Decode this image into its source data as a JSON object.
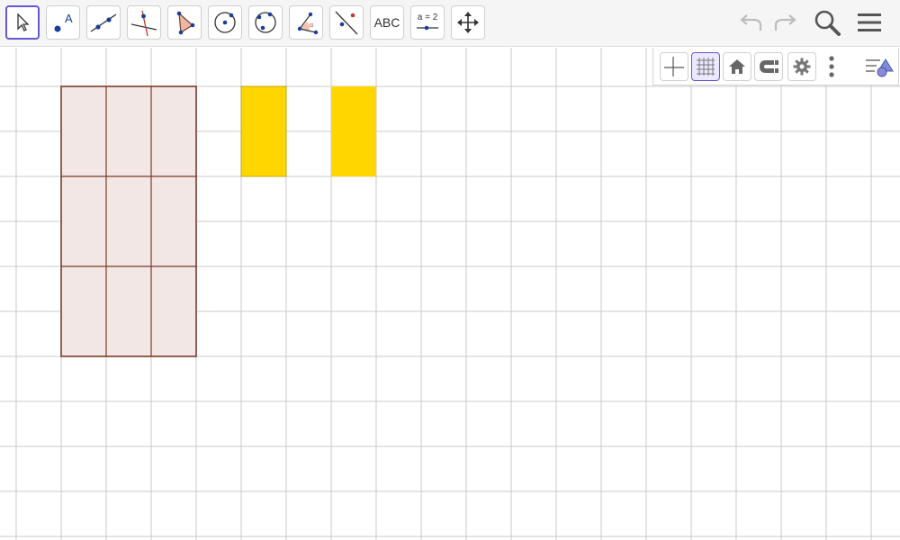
{
  "toolbar": {
    "tools": [
      {
        "name": "move-tool",
        "selected": true
      },
      {
        "name": "point-tool"
      },
      {
        "name": "line-tool"
      },
      {
        "name": "perpendicular-line-tool"
      },
      {
        "name": "polygon-tool"
      },
      {
        "name": "circle-center-point-tool"
      },
      {
        "name": "circle-three-points-tool"
      },
      {
        "name": "angle-tool"
      },
      {
        "name": "reflect-about-line-tool"
      },
      {
        "name": "text-tool",
        "label": "ABC"
      },
      {
        "name": "slider-tool",
        "label": "a = 2"
      },
      {
        "name": "move-graphics-view-tool"
      }
    ],
    "right": [
      "undo-icon",
      "redo-icon",
      "search-icon",
      "menu-icon"
    ]
  },
  "graphics_style_bar": [
    "axes-toggle",
    "grid-toggle",
    "standard-view-home",
    "point-capturing",
    "settings",
    "more-options",
    "algebra-view-toggle"
  ],
  "colors": {
    "grid_line": "#c8c8c8",
    "large_rect_fill": "#f2e7e4",
    "large_rect_stroke": "#7a3b2a",
    "yellow_fill": "#ffd600",
    "accent": "#6557d2"
  },
  "shapes": [
    {
      "id": "large-rectangle",
      "cols": 3,
      "rows": 3
    },
    {
      "id": "yellow-rectangle-1"
    },
    {
      "id": "yellow-rectangle-2"
    }
  ]
}
